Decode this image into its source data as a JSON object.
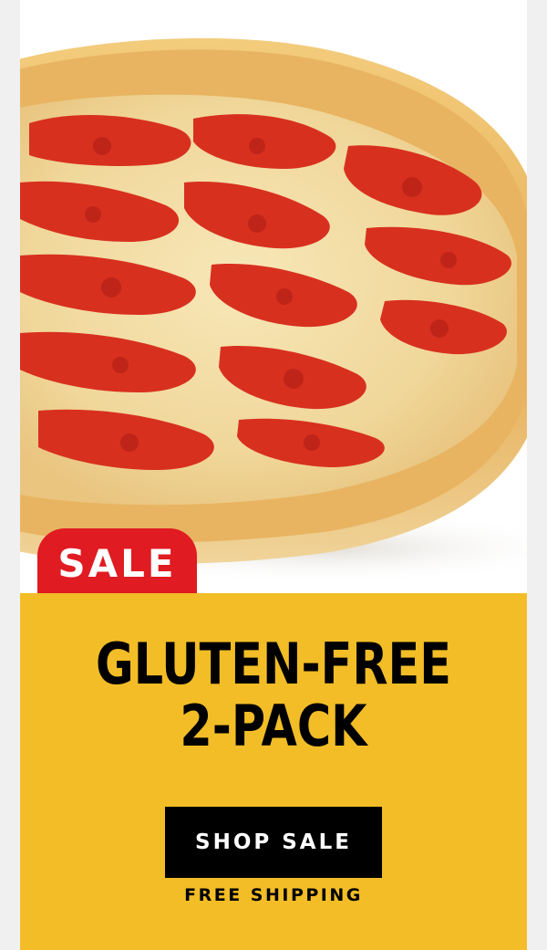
{
  "hero": {
    "image_subject": "pizza-image",
    "badge_label": "SALE",
    "badge_color": "#e01b22"
  },
  "promo": {
    "headline_line1": "GLUTEN-FREE",
    "headline_line2": "2-PACK",
    "cta_label": "SHOP SALE",
    "shipping_note": "FREE SHIPPING",
    "panel_color": "#f2bd26"
  }
}
